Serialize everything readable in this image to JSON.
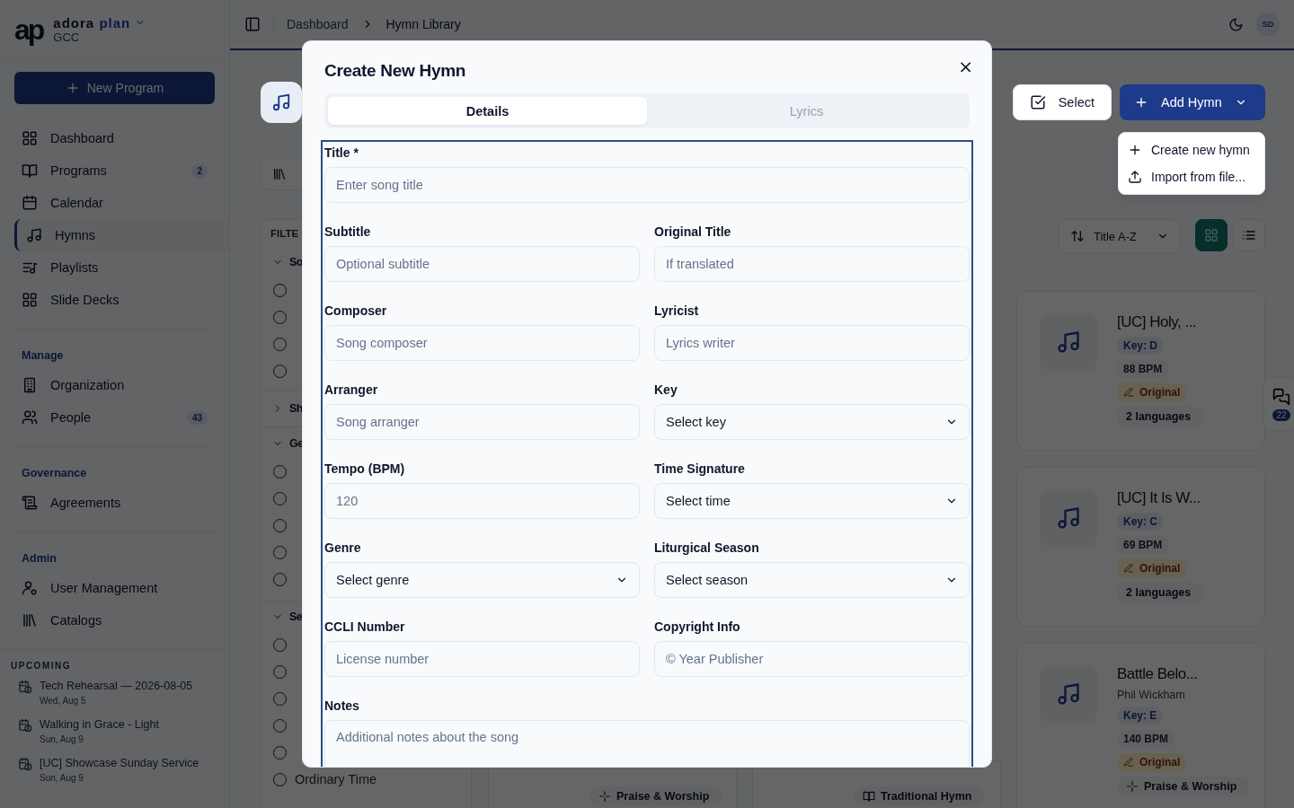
{
  "sidebar": {
    "logo": "ap",
    "brand": "adora",
    "brand_accent": "plan",
    "org": "GCC",
    "new_button": "New Program",
    "nav": [
      {
        "label": "Dashboard",
        "selected": false
      },
      {
        "label": "Programs",
        "badge": "2",
        "selected": false
      },
      {
        "label": "Calendar",
        "selected": false
      },
      {
        "label": "Hymns",
        "selected": true
      },
      {
        "label": "Playlists",
        "selected": false
      },
      {
        "label": "Slide Decks",
        "selected": false
      }
    ],
    "sections": [
      {
        "heading": "Manage",
        "items": [
          {
            "label": "Organization"
          },
          {
            "label": "People",
            "badge": "43"
          }
        ]
      },
      {
        "heading": "Governance",
        "items": [
          {
            "label": "Agreements"
          }
        ]
      },
      {
        "heading": "Admin",
        "items": [
          {
            "label": "User Management"
          },
          {
            "label": "Catalogs"
          }
        ]
      }
    ],
    "upcoming": {
      "heading": "UPCOMING",
      "events": [
        {
          "title": "Tech Rehearsal — 2026-08-05",
          "date": "Wed, Aug 5"
        },
        {
          "title": "Walking in Grace - Light",
          "date": "Sun, Aug 9"
        },
        {
          "title": "[UC] Showcase Sunday Service",
          "date": "Sun, Aug 9"
        }
      ]
    }
  },
  "topbar": {
    "breadcrumb": [
      "Dashboard",
      "Hymn Library"
    ],
    "avatar": "SD"
  },
  "header": {
    "select_button": "Select",
    "add_button": "Add Hymn",
    "menu": [
      "Create new hymn",
      "Import from file..."
    ]
  },
  "filters": {
    "heading": "FILTE",
    "groups": [
      {
        "label": "So",
        "expanded": true,
        "options": [
          {
            "checked": false
          },
          {
            "checked": false
          },
          {
            "checked": false
          },
          {
            "checked": false
          }
        ]
      },
      {
        "label": "Sh",
        "expanded": false
      },
      {
        "label": "Ge",
        "expanded": true,
        "options": [
          {
            "checked": false
          },
          {
            "checked": false
          },
          {
            "checked": false
          },
          {
            "checked": false
          },
          {
            "checked": false
          }
        ]
      },
      {
        "label": "Se",
        "expanded": true,
        "options": [
          {
            "checked": false
          },
          {
            "checked": false
          },
          {
            "checked": false
          },
          {
            "checked": false
          },
          {
            "checked": false
          },
          {
            "checked": false,
            "label": "Ordinary Time"
          }
        ]
      }
    ]
  },
  "sort": {
    "value": "Title A-Z"
  },
  "views": [
    {
      "kind": "grid",
      "selected": true
    },
    {
      "kind": "list",
      "selected": false
    }
  ],
  "card_footers": [
    {
      "kind": "praise",
      "label": "Praise & Worship"
    },
    {
      "kind": "traditional",
      "label": "Traditional Hymn"
    }
  ],
  "cards": [
    {
      "title": "[UC] Holy, ...",
      "key": "Key: D",
      "bpm": "88 BPM",
      "source": "Original",
      "extra": {
        "kind": "languages",
        "label": "2 languages"
      }
    },
    {
      "title": "[UC] It Is W...",
      "key": "Key: C",
      "bpm": "69 BPM",
      "source": "Original",
      "extra": {
        "kind": "languages",
        "label": "2 languages"
      }
    },
    {
      "title": "Battle Belo...",
      "author": "Phil Wickham",
      "key": "Key: E",
      "bpm": "140 BPM",
      "source": "Original",
      "extra": {
        "kind": "praise",
        "label": "Praise & Worship"
      }
    }
  ],
  "feedback": {
    "count": "22"
  },
  "dialog": {
    "title": "Create New Hymn",
    "close": "×",
    "tabs": [
      {
        "label": "Details",
        "selected": true
      },
      {
        "label": "Lyrics",
        "selected": false
      }
    ],
    "fields": [
      {
        "label": "Title *",
        "kind": "text",
        "placeholder": "Enter song title"
      },
      {
        "label": "Subtitle",
        "kind": "text",
        "placeholder": "Optional subtitle"
      },
      {
        "label": "Original Title",
        "kind": "text",
        "placeholder": "If translated"
      },
      {
        "label": "Composer",
        "kind": "text",
        "placeholder": "Song composer"
      },
      {
        "label": "Lyricist",
        "kind": "text",
        "placeholder": "Lyrics writer"
      },
      {
        "label": "Arranger",
        "kind": "text",
        "placeholder": "Song arranger"
      },
      {
        "label": "Key",
        "kind": "select",
        "placeholder": "Select key"
      },
      {
        "label": "Tempo (BPM)",
        "kind": "text",
        "placeholder": "120"
      },
      {
        "label": "Time Signature",
        "kind": "select",
        "placeholder": "Select time"
      },
      {
        "label": "Genre",
        "kind": "select",
        "placeholder": "Select genre"
      },
      {
        "label": "Liturgical Season",
        "kind": "select",
        "placeholder": "Select season"
      },
      {
        "label": "CCLI Number",
        "kind": "text",
        "placeholder": "License number"
      },
      {
        "label": "Copyright Info",
        "kind": "text",
        "placeholder": "© Year Publisher"
      },
      {
        "label": "Notes",
        "kind": "textarea",
        "placeholder": "Additional notes about the song"
      }
    ]
  }
}
